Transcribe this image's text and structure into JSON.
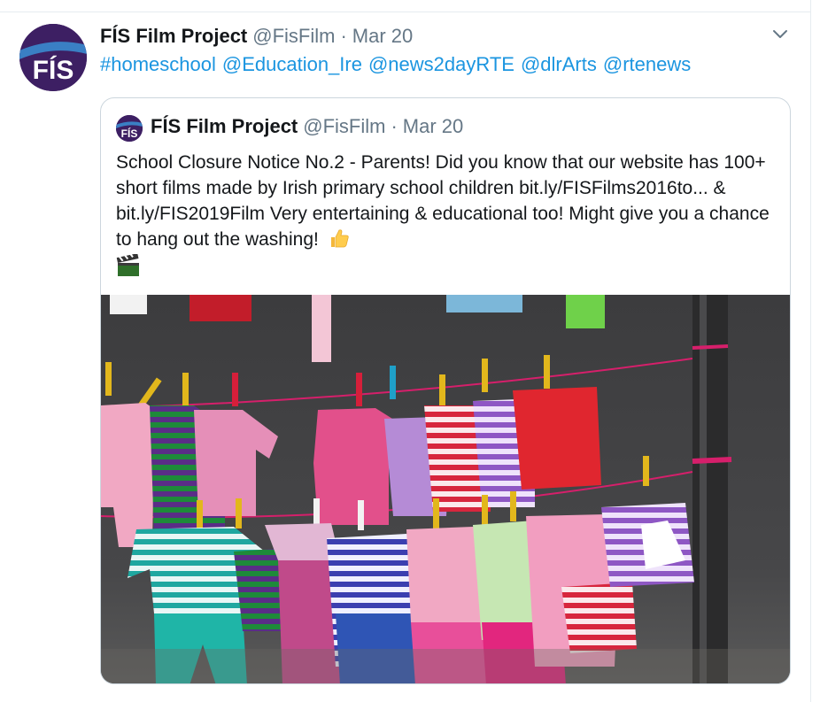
{
  "tweet": {
    "author_name": "FÍS Film Project",
    "author_handle": "@FisFilm",
    "separator": "·",
    "date": "Mar 20",
    "avatar_text": "FÍS",
    "menu_icon": "chevron-down-icon",
    "hashtags": [
      "#homeschool",
      "@Education_Ire",
      "@news2dayRTE",
      "@dlrArts",
      "@rtenews"
    ]
  },
  "quote": {
    "author_name": "FÍS Film Project",
    "author_handle": "@FisFilm",
    "separator": "·",
    "date": "Mar 20",
    "text": "School Closure Notice No.2 - Parents! Did you know that our website has 100+ short films made by Irish primary school children bit.ly/FISFilms2016to... & bit.ly/FIS2019Film Very entertaining & educational too! Might give you a chance to hang out the washing!",
    "emojis": [
      "thumbs-up-icon",
      "clapper-board-icon"
    ],
    "image": "knitted-baby-clothes-on-washing-line"
  },
  "colors": {
    "link": "#1b95e0",
    "text": "#14171a",
    "secondary": "#657786",
    "border": "#ccd6dd",
    "brand_purple": "#3d1f63",
    "brand_blue": "#3a7fc4"
  }
}
